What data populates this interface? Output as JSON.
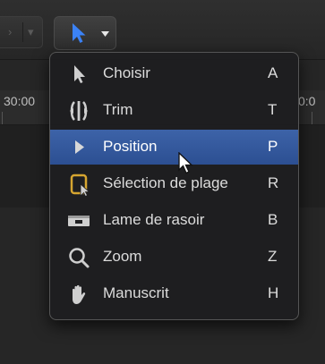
{
  "toolbar": {
    "tool_selector": {
      "current_tool": "pointer",
      "icon": "arrow-pointer-icon",
      "dropdown_icon": "chevron-down-icon"
    }
  },
  "timeline": {
    "ruler_left": "30:00",
    "ruler_right": "0:0"
  },
  "tools_menu": {
    "items": [
      {
        "label": "Choisir",
        "shortcut": "A",
        "icon": "arrow-select-icon",
        "selected": false
      },
      {
        "label": "Trim",
        "shortcut": "T",
        "icon": "trim-icon",
        "selected": false
      },
      {
        "label": "Position",
        "shortcut": "P",
        "icon": "position-icon",
        "selected": true
      },
      {
        "label": "Sélection de plage",
        "shortcut": "R",
        "icon": "range-selection-icon",
        "selected": false
      },
      {
        "label": "Lame de rasoir",
        "shortcut": "B",
        "icon": "blade-icon",
        "selected": false
      },
      {
        "label": "Zoom",
        "shortcut": "Z",
        "icon": "zoom-icon",
        "selected": false
      },
      {
        "label": "Manuscrit",
        "shortcut": "H",
        "icon": "hand-icon",
        "selected": false
      }
    ]
  },
  "colors": {
    "accent": "#2f5597",
    "tool_active": "#3b82f6",
    "range_icon": "#d6a530"
  }
}
